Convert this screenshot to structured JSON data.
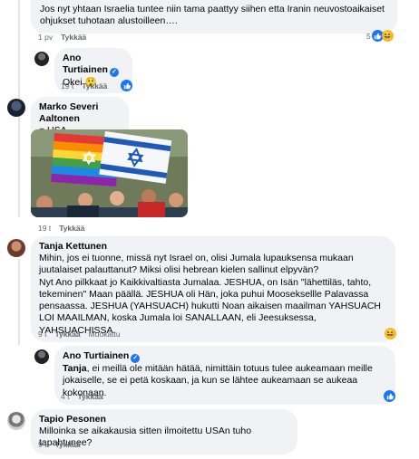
{
  "comments": [
    {
      "text": "Jos nyt yhtaan Israelia tuntee niin tama paattyy siihen etta Iranin neuvostoaikaiset ohjukset tuhotaan alustoilleen….",
      "time": "1 pv",
      "like": "Tykkää",
      "reaction_count": "5"
    },
    {
      "author": "Ano Turtiainen",
      "text": "Okei",
      "emoji": "😲",
      "time": "19 t",
      "like": "Tykkää"
    },
    {
      "author": "Marko Severi Aaltonen",
      "text": "= USA",
      "time": "19 t",
      "like": "Tykkää"
    },
    {
      "author": "Tanja Kettunen",
      "lines": [
        "Mihin, jos ei tuonne, missä nyt Israel on, olisi Jumala lupauksensa mukaan juutalaiset palauttanut? Miksi olisi hebrean kielen sallinut elpyvän?",
        "Nyt Ano pilkkaat jo Kaikkivaltiasta Jumalaa. JESHUA, on Isän \"lähettiläs, tahto, tekeminen\" Maan päällä. JESHUA oli Hän, joka puhui Mooseksellle Palavassa pensaassa. JESHUA (YAHSUACH) hukutti Noan aikaisen maailman YAHSUACH LOI MAAILMAN, koska Jumala loi SANALLAAN, eli Jeesuksessa, YAHSUACHISSA."
      ],
      "time": "9 t",
      "like": "Tykkää",
      "edited": "Muokattu"
    },
    {
      "author": "Ano Turtiainen",
      "mention": "Tanja",
      "text": ", ei meillä ole mitään hätää, nimittäin totuus tulee aukeamaan meille jokaiselle, se ei petä koskaan, ja kun se lähtee aukeamaan se aukeaa kokonaan.",
      "time": "4 t",
      "like": "Tykkää"
    },
    {
      "author": "Tapio Pesonen",
      "text": "Milloinka se aikakausia sitten ilmoitettu USAn tuho tapahtunee?",
      "time": "9 t",
      "like": "Tykkää"
    }
  ],
  "icons": {
    "like": "thumbs-up-icon",
    "haha": "haha-reaction-icon",
    "verified": "verified-badge-icon"
  },
  "colors": {
    "bubble": "#f0f2f5",
    "accent": "#1877f2",
    "meta": "#65676b"
  }
}
